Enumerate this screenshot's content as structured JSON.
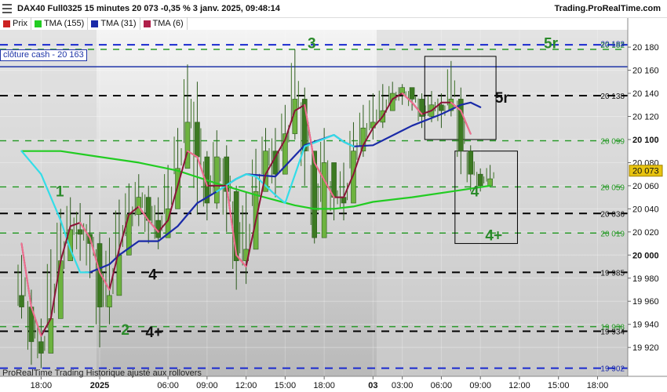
{
  "header": {
    "title": "DAX40 Full0325 15 minutes 20 073 -0,35 % 3 janv. 2025, 09:48:14",
    "brand": "Trading.ProRealTime.com"
  },
  "legend": [
    {
      "label": "Prix",
      "color": "#cc2222"
    },
    {
      "label": "TMA (155)",
      "color": "#22cc22"
    },
    {
      "label": "TMA (31)",
      "color": "#1a2aa8"
    },
    {
      "label": "TMA (6)",
      "color": "#b0204a"
    }
  ],
  "cash_label": "clôture cash -  20 163",
  "footer": "ProRealTime Trading  Historique ajusté aux rollovers",
  "chart_data": {
    "type": "candlestick",
    "ylim": [
      19895,
      20195
    ],
    "y_ticks": [
      {
        "v": 20180,
        "t": "20 180"
      },
      {
        "v": 20160,
        "t": "20 160"
      },
      {
        "v": 20140,
        "t": "20 140"
      },
      {
        "v": 20120,
        "t": "20 120"
      },
      {
        "v": 20100,
        "t": "20 100",
        "bold": true
      },
      {
        "v": 20080,
        "t": "20 080"
      },
      {
        "v": 20060,
        "t": "20 060"
      },
      {
        "v": 20040,
        "t": "20 040"
      },
      {
        "v": 20020,
        "t": "20 020"
      },
      {
        "v": 20000,
        "t": "20 000",
        "bold": true
      },
      {
        "v": 19980,
        "t": "19 980"
      },
      {
        "v": 19960,
        "t": "19 960"
      },
      {
        "v": 19940,
        "t": "19 940"
      },
      {
        "v": 19920,
        "t": "19 920"
      }
    ],
    "x_ticks": [
      {
        "i": 2,
        "t": "18:00"
      },
      {
        "i": 8,
        "t": "2025",
        "bold": true
      },
      {
        "i": 15,
        "t": "06:00"
      },
      {
        "i": 19,
        "t": "09:00"
      },
      {
        "i": 23,
        "t": "12:00"
      },
      {
        "i": 27,
        "t": "15:00"
      },
      {
        "i": 31,
        "t": "18:00"
      },
      {
        "i": 36,
        "t": "03",
        "bold": true
      },
      {
        "i": 39,
        "t": "03:00"
      },
      {
        "i": 43,
        "t": "06:00"
      },
      {
        "i": 47,
        "t": "09:00"
      },
      {
        "i": 51,
        "t": "12:00"
      },
      {
        "i": 55,
        "t": "15:00"
      },
      {
        "i": 59,
        "t": "18:00"
      }
    ],
    "levels": [
      {
        "v": 20182,
        "style": "blue-dash",
        "label": "20 182",
        "lc": "#2a9a2a"
      },
      {
        "v": 20183,
        "style": "none",
        "label": "20 183",
        "lc": "#1a2aa8"
      },
      {
        "v": 20178,
        "style": "green-dash"
      },
      {
        "v": 20163,
        "style": "blue-solid"
      },
      {
        "v": 20138,
        "style": "black-dash",
        "label": "20 138",
        "lc": "#111"
      },
      {
        "v": 20099,
        "style": "green-dash",
        "label": "20 099",
        "lc": "#2a9a2a"
      },
      {
        "v": 20059,
        "style": "green-dash",
        "label": "20 059",
        "lc": "#2a9a2a"
      },
      {
        "v": 20036,
        "style": "black-dash",
        "label": "20 036",
        "lc": "#111"
      },
      {
        "v": 20019,
        "style": "green-dash",
        "label": "20 019",
        "lc": "#2a9a2a"
      },
      {
        "v": 19985,
        "style": "black-dash",
        "label": "19 985",
        "lc": "#111"
      },
      {
        "v": 19938,
        "style": "green-dash",
        "label": "19 938",
        "lc": "#2a9a2a"
      },
      {
        "v": 19934,
        "style": "black-dash",
        "label": "19 934",
        "lc": "#111"
      },
      {
        "v": 19902,
        "style": "blue-dash",
        "label": "19 902",
        "lc": "#1a2aa8"
      }
    ],
    "current_price": {
      "v": 20073,
      "t": "20 073"
    },
    "annotations": [
      {
        "t": "3",
        "i": 29.3,
        "v": 20183,
        "c": "#2a8a2a"
      },
      {
        "t": "5r",
        "i": 53.5,
        "v": 20183,
        "c": "#2a8a2a"
      },
      {
        "t": "5r",
        "i": 48.5,
        "v": 20136,
        "c": "#111"
      },
      {
        "t": "1",
        "i": 3.5,
        "v": 20055,
        "c": "#2a8a2a"
      },
      {
        "t": "4",
        "i": 46.0,
        "v": 20055,
        "c": "#2a8a2a"
      },
      {
        "t": "4+",
        "i": 47.5,
        "v": 20017,
        "c": "#2a8a2a"
      },
      {
        "t": "4",
        "i": 13.0,
        "v": 19983,
        "c": "#111"
      },
      {
        "t": "2",
        "i": 10.2,
        "v": 19935,
        "c": "#2a8a2a"
      },
      {
        "t": "4+",
        "i": 12.7,
        "v": 19933,
        "c": "#111"
      }
    ],
    "boxes": [
      {
        "i0": 41.3,
        "i1": 48.6,
        "v0": 20100,
        "v1": 20172
      },
      {
        "i0": 44.4,
        "i1": 50.8,
        "v0": 20010,
        "v1": 20090
      }
    ],
    "close": [
      19955,
      19925,
      19915,
      19945,
      19995,
      20022,
      20018,
      20010,
      19955,
      19965,
      20000,
      20035,
      20050,
      20030,
      20015,
      20040,
      20075,
      20115,
      20085,
      20045,
      20085,
      20055,
      19995,
      20005,
      20055,
      20090,
      20070,
      20105,
      20135,
      20090,
      20015,
      20080,
      20050,
      20045,
      20090,
      20110,
      20115,
      20125,
      20140,
      20145,
      20135,
      20120,
      20130,
      20125,
      20135,
      20090,
      20070,
      20060,
      20066
    ],
    "high": [
      20000,
      19970,
      19945,
      20005,
      20040,
      20050,
      20045,
      20035,
      20020,
      20015,
      20048,
      20062,
      20070,
      20060,
      20050,
      20078,
      20110,
      20165,
      20150,
      20090,
      20108,
      20095,
      20060,
      20055,
      20092,
      20110,
      20110,
      20130,
      20178,
      20145,
      20090,
      20110,
      20070,
      20080,
      20115,
      20130,
      20140,
      20148,
      20150,
      20148,
      20145,
      20140,
      20142,
      20140,
      20168,
      20145,
      20095,
      20075,
      20078
    ],
    "low": [
      19945,
      19905,
      19902,
      19920,
      19960,
      20000,
      19995,
      19980,
      19920,
      19940,
      19985,
      20005,
      20025,
      20010,
      20005,
      20025,
      20060,
      20080,
      20035,
      20030,
      20040,
      20020,
      19970,
      19975,
      20030,
      20060,
      20050,
      20080,
      20100,
      20060,
      20010,
      20030,
      20030,
      20030,
      20065,
      20085,
      20100,
      20110,
      20125,
      20130,
      20125,
      20110,
      20115,
      20110,
      20120,
      20070,
      20055,
      20055,
      20060
    ]
  },
  "tma": {
    "tma155": [
      [
        0,
        20090
      ],
      [
        4,
        20090
      ],
      [
        8,
        20085
      ],
      [
        12,
        20080
      ],
      [
        16,
        20073
      ],
      [
        20,
        20062
      ],
      [
        24,
        20052
      ],
      [
        28,
        20043
      ],
      [
        30,
        20040
      ],
      [
        32,
        20040
      ],
      [
        34,
        20042
      ],
      [
        36,
        20046
      ],
      [
        40,
        20050
      ],
      [
        44,
        20055
      ],
      [
        48,
        20060
      ]
    ],
    "tma155_cyan": [
      [
        0,
        20090
      ],
      [
        2,
        20070
      ],
      [
        4,
        20030
      ],
      [
        5,
        20005
      ],
      [
        6,
        19985
      ],
      [
        7,
        19985
      ]
    ],
    "tma31": [
      [
        7,
        19985
      ],
      [
        9,
        19992
      ],
      [
        10,
        20000
      ],
      [
        12,
        20012
      ],
      [
        14,
        20012
      ],
      [
        16,
        20025
      ],
      [
        18,
        20045
      ],
      [
        20,
        20055
      ],
      [
        22,
        20066
      ],
      [
        23,
        20070
      ],
      [
        26,
        20068
      ],
      [
        29,
        20095
      ],
      [
        32,
        20104
      ],
      [
        33,
        20098
      ],
      [
        34,
        20094
      ],
      [
        36,
        20095
      ],
      [
        40,
        20112
      ],
      [
        43,
        20122
      ],
      [
        45,
        20130
      ],
      [
        46,
        20132
      ],
      [
        47,
        20128
      ]
    ],
    "tma31_cyan": [
      [
        20,
        20055
      ],
      [
        22,
        20066
      ],
      [
        23,
        20070
      ],
      [
        24,
        20068
      ],
      [
        26,
        20052
      ],
      [
        27,
        20045
      ],
      [
        29,
        20094
      ],
      [
        32,
        20104
      ],
      [
        33,
        20098
      ],
      [
        34,
        20094
      ]
    ],
    "tma6": [
      [
        0,
        20010
      ],
      [
        1,
        19955
      ],
      [
        2,
        19930
      ],
      [
        3,
        19945
      ],
      [
        4,
        19995
      ],
      [
        5,
        20025
      ],
      [
        6,
        20028
      ],
      [
        7,
        20015
      ],
      [
        8,
        19985
      ],
      [
        9,
        19970
      ],
      [
        10,
        20005
      ],
      [
        11,
        20035
      ],
      [
        12,
        20042
      ],
      [
        13,
        20030
      ],
      [
        14,
        20020
      ],
      [
        15,
        20030
      ],
      [
        16,
        20060
      ],
      [
        17,
        20090
      ],
      [
        18,
        20085
      ],
      [
        19,
        20060
      ],
      [
        20,
        20060
      ],
      [
        21,
        20060
      ],
      [
        22,
        20000
      ],
      [
        23,
        19990
      ],
      [
        24,
        20030
      ],
      [
        25,
        20070
      ],
      [
        26,
        20085
      ],
      [
        27,
        20100
      ],
      [
        28,
        20125
      ],
      [
        29,
        20130
      ],
      [
        30,
        20080
      ],
      [
        31,
        20065
      ],
      [
        32,
        20050
      ],
      [
        33,
        20050
      ],
      [
        34,
        20070
      ],
      [
        35,
        20095
      ],
      [
        36,
        20110
      ],
      [
        37,
        20120
      ],
      [
        38,
        20135
      ],
      [
        39,
        20140
      ],
      [
        40,
        20132
      ],
      [
        41,
        20122
      ],
      [
        42,
        20125
      ],
      [
        43,
        20132
      ],
      [
        44,
        20132
      ],
      [
        45,
        20125
      ],
      [
        46,
        20105
      ]
    ]
  }
}
